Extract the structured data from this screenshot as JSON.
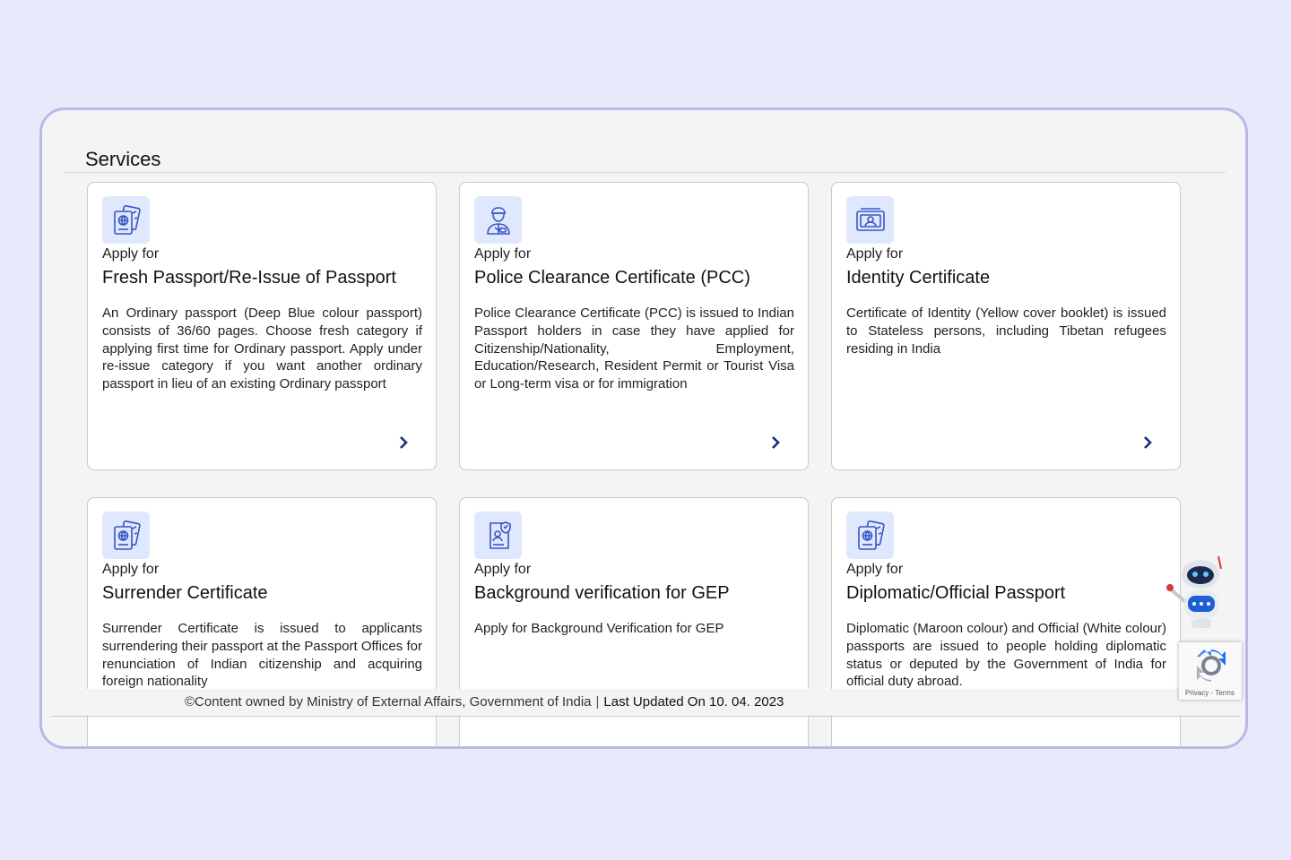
{
  "section": {
    "title": "Services"
  },
  "cards": [
    {
      "apply_label": "Apply for",
      "title": "Fresh Passport/Re-Issue of Passport",
      "description": "An Ordinary passport (Deep Blue colour passport) consists of 36/60 pages. Choose fresh category if applying first time for Ordinary passport. Apply under re-issue category if you want another ordinary passport in lieu of an existing Ordinary passport",
      "icon": "passport-icon"
    },
    {
      "apply_label": "Apply for",
      "title": "Police Clearance Certificate (PCC)",
      "description": "Police Clearance Certificate (PCC) is issued to Indian Passport holders in case they have applied for Citizenship/Nationality, Employment, Education/Research, Resident Permit or Tourist Visa or Long-term visa or for immigration",
      "icon": "police-officer-icon"
    },
    {
      "apply_label": "Apply for",
      "title": "Identity Certificate",
      "description": "Certificate of Identity (Yellow cover booklet) is issued to Stateless persons, including Tibetan refugees residing in India",
      "icon": "id-card-icon"
    },
    {
      "apply_label": "Apply for",
      "title": "Surrender Certificate",
      "description": "Surrender Certificate is issued to applicants surrendering their passport at the Passport Offices for renunciation of Indian citizenship and acquiring foreign nationality",
      "icon": "passport-icon"
    },
    {
      "apply_label": "Apply for",
      "title": "Background verification for GEP",
      "description": "Apply for Background Verification for GEP",
      "icon": "verified-document-icon"
    },
    {
      "apply_label": "Apply for",
      "title": "Diplomatic/Official Passport",
      "description": "Diplomatic (Maroon colour) and Official (White colour) passports are issued to people holding diplomatic status or deputed by the Government of India for official duty abroad.",
      "icon": "passport-icon"
    }
  ],
  "footer": {
    "ownership": "©Content owned by Ministry of External Affairs, Government of India",
    "separator": "|",
    "last_updated": "Last Updated On 10. 04. 2023"
  },
  "recaptcha": {
    "links": "Privacy - Terms"
  },
  "colors": {
    "page_bg": "#e8eafb",
    "frame_border": "#b7b9ea",
    "icon_tile": "#dfe8fd",
    "icon_stroke": "#3a55c4",
    "chevron": "#1c2a7a"
  }
}
